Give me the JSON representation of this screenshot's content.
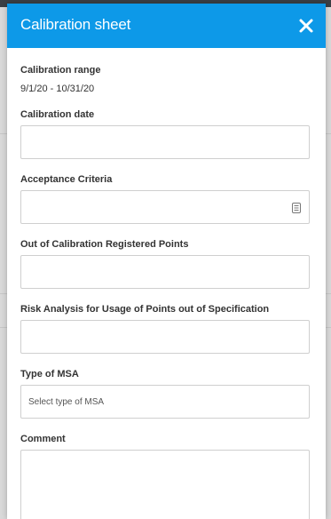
{
  "modal": {
    "title": "Calibration sheet",
    "close_icon": "close-icon"
  },
  "fields": {
    "calibration_range": {
      "label": "Calibration range",
      "value": "9/1/20 - 10/31/20"
    },
    "calibration_date": {
      "label": "Calibration date",
      "value": ""
    },
    "acceptance_criteria": {
      "label": "Acceptance Criteria",
      "value": "",
      "icon": "list-icon"
    },
    "out_of_calibration": {
      "label": "Out of Calibration Registered Points",
      "value": ""
    },
    "risk_analysis": {
      "label": "Risk Analysis for Usage of Points out of Specification",
      "value": ""
    },
    "type_of_msa": {
      "label": "Type of MSA",
      "placeholder": "Select type of MSA"
    },
    "comment": {
      "label": "Comment",
      "value": ""
    }
  },
  "colors": {
    "header": "#0d99e8",
    "label": "#333333",
    "border": "#cfcfcf"
  }
}
